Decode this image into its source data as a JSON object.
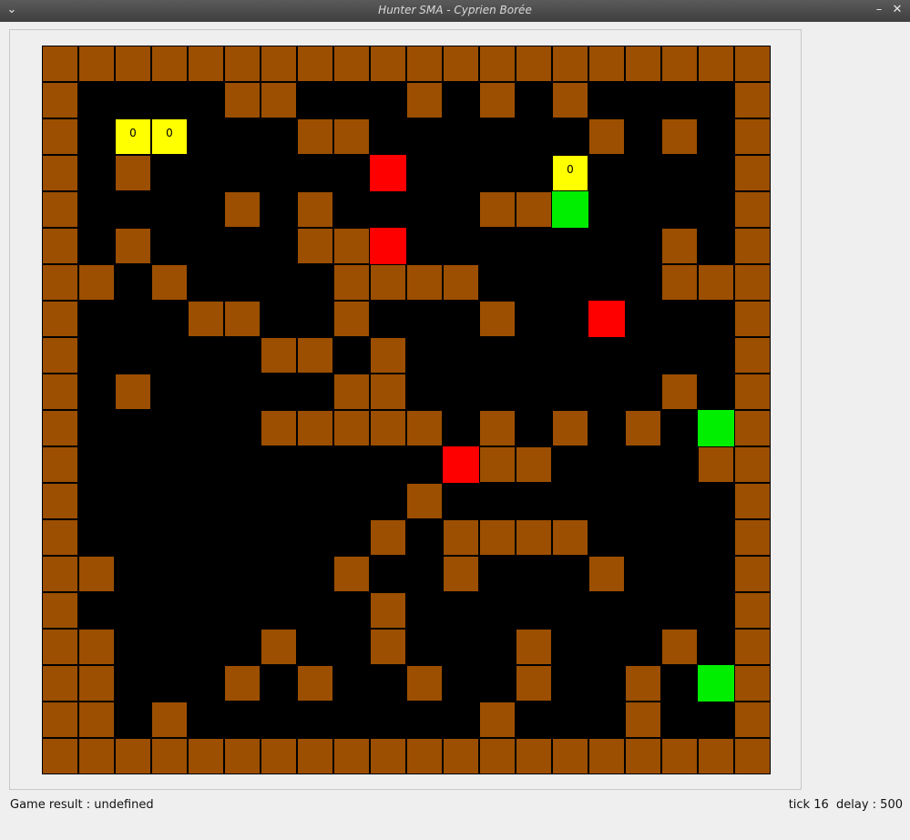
{
  "window": {
    "title": "Hunter SMA - Cyprien Borée",
    "menu_icon": "chevron-down-icon",
    "min_icon": "minimize-icon",
    "close_icon": "close-icon"
  },
  "colors": {
    "wall": "#9c4f00",
    "floor": "#000000",
    "hunter": "#ffff00",
    "avatar": "#ff0000",
    "defender": "#00ee00"
  },
  "board": {
    "cols": 20,
    "rows": 20,
    "walls": [
      [
        0,
        0
      ],
      [
        1,
        0
      ],
      [
        2,
        0
      ],
      [
        3,
        0
      ],
      [
        4,
        0
      ],
      [
        5,
        0
      ],
      [
        6,
        0
      ],
      [
        7,
        0
      ],
      [
        8,
        0
      ],
      [
        9,
        0
      ],
      [
        10,
        0
      ],
      [
        11,
        0
      ],
      [
        12,
        0
      ],
      [
        13,
        0
      ],
      [
        14,
        0
      ],
      [
        15,
        0
      ],
      [
        16,
        0
      ],
      [
        17,
        0
      ],
      [
        18,
        0
      ],
      [
        19,
        0
      ],
      [
        0,
        1
      ],
      [
        5,
        1
      ],
      [
        6,
        1
      ],
      [
        10,
        1
      ],
      [
        12,
        1
      ],
      [
        14,
        1
      ],
      [
        19,
        1
      ],
      [
        0,
        2
      ],
      [
        7,
        2
      ],
      [
        8,
        2
      ],
      [
        15,
        2
      ],
      [
        17,
        2
      ],
      [
        19,
        2
      ],
      [
        0,
        3
      ],
      [
        2,
        3
      ],
      [
        19,
        3
      ],
      [
        0,
        4
      ],
      [
        5,
        4
      ],
      [
        7,
        4
      ],
      [
        12,
        4
      ],
      [
        13,
        4
      ],
      [
        19,
        4
      ],
      [
        0,
        5
      ],
      [
        2,
        5
      ],
      [
        7,
        5
      ],
      [
        8,
        5
      ],
      [
        17,
        5
      ],
      [
        19,
        5
      ],
      [
        0,
        6
      ],
      [
        1,
        6
      ],
      [
        3,
        6
      ],
      [
        8,
        6
      ],
      [
        9,
        6
      ],
      [
        10,
        6
      ],
      [
        11,
        6
      ],
      [
        17,
        6
      ],
      [
        18,
        6
      ],
      [
        19,
        6
      ],
      [
        0,
        7
      ],
      [
        4,
        7
      ],
      [
        5,
        7
      ],
      [
        8,
        7
      ],
      [
        12,
        7
      ],
      [
        19,
        7
      ],
      [
        0,
        8
      ],
      [
        6,
        8
      ],
      [
        7,
        8
      ],
      [
        9,
        8
      ],
      [
        19,
        8
      ],
      [
        0,
        9
      ],
      [
        2,
        9
      ],
      [
        8,
        9
      ],
      [
        9,
        9
      ],
      [
        17,
        9
      ],
      [
        19,
        9
      ],
      [
        0,
        10
      ],
      [
        6,
        10
      ],
      [
        7,
        10
      ],
      [
        8,
        10
      ],
      [
        9,
        10
      ],
      [
        10,
        10
      ],
      [
        12,
        10
      ],
      [
        14,
        10
      ],
      [
        16,
        10
      ],
      [
        19,
        10
      ],
      [
        0,
        11
      ],
      [
        12,
        11
      ],
      [
        13,
        11
      ],
      [
        18,
        11
      ],
      [
        19,
        11
      ],
      [
        0,
        12
      ],
      [
        10,
        12
      ],
      [
        19,
        12
      ],
      [
        0,
        13
      ],
      [
        9,
        13
      ],
      [
        11,
        13
      ],
      [
        12,
        13
      ],
      [
        13,
        13
      ],
      [
        14,
        13
      ],
      [
        19,
        13
      ],
      [
        0,
        14
      ],
      [
        1,
        14
      ],
      [
        8,
        14
      ],
      [
        11,
        14
      ],
      [
        15,
        14
      ],
      [
        19,
        14
      ],
      [
        0,
        15
      ],
      [
        9,
        15
      ],
      [
        19,
        15
      ],
      [
        0,
        16
      ],
      [
        1,
        16
      ],
      [
        6,
        16
      ],
      [
        9,
        16
      ],
      [
        13,
        16
      ],
      [
        17,
        16
      ],
      [
        19,
        16
      ],
      [
        0,
        17
      ],
      [
        1,
        17
      ],
      [
        5,
        17
      ],
      [
        7,
        17
      ],
      [
        10,
        17
      ],
      [
        13,
        17
      ],
      [
        16,
        17
      ],
      [
        19,
        17
      ],
      [
        0,
        18
      ],
      [
        1,
        18
      ],
      [
        3,
        18
      ],
      [
        12,
        18
      ],
      [
        16,
        18
      ],
      [
        19,
        18
      ],
      [
        0,
        19
      ],
      [
        1,
        19
      ],
      [
        2,
        19
      ],
      [
        3,
        19
      ],
      [
        4,
        19
      ],
      [
        5,
        19
      ],
      [
        6,
        19
      ],
      [
        7,
        19
      ],
      [
        8,
        19
      ],
      [
        9,
        19
      ],
      [
        10,
        19
      ],
      [
        11,
        19
      ],
      [
        12,
        19
      ],
      [
        13,
        19
      ],
      [
        14,
        19
      ],
      [
        15,
        19
      ],
      [
        16,
        19
      ],
      [
        17,
        19
      ],
      [
        18,
        19
      ],
      [
        19,
        19
      ]
    ],
    "hunters": [
      {
        "col": 2,
        "row": 2,
        "label": "0"
      },
      {
        "col": 3,
        "row": 2,
        "label": "0"
      },
      {
        "col": 14,
        "row": 3,
        "label": "0"
      }
    ],
    "reds": [
      [
        9,
        3
      ],
      [
        9,
        5
      ],
      [
        15,
        7
      ],
      [
        11,
        11
      ]
    ],
    "greens": [
      [
        14,
        4
      ],
      [
        18,
        10
      ],
      [
        18,
        17
      ]
    ]
  },
  "status": {
    "result": "Game result : undefined",
    "tick": "tick 16  delay : 500"
  }
}
